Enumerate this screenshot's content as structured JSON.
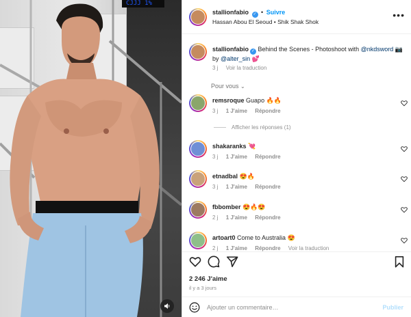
{
  "media": {
    "clock_text": "CJJJ 1%",
    "sound_icon": "speaker-icon"
  },
  "header": {
    "username": "stallionfabio",
    "follow_label": "Suivre",
    "subtitle": "Hassan Abou El Seoud • Shik Shak Shok",
    "more_icon": "more-icon"
  },
  "caption": {
    "username": "stallionfabio",
    "text_before": "Behind the Scenes - Photoshoot with",
    "mention_1": "@nkdsword",
    "text_mid": "📷 by",
    "mention_2": "@alter_sin",
    "emoji_end": "💕",
    "time": "3 j",
    "translate": "Voir la traduction"
  },
  "filter": {
    "label": "Pour vous",
    "icon": "chevron-down-icon"
  },
  "comments": [
    {
      "username": "remsroque",
      "text": "Guapo 🔥🔥",
      "time": "3 j",
      "likes": "1 J'aime",
      "reply": "Répondre",
      "avatar_color": "#8aa66b"
    },
    {
      "username": "shakaranks",
      "text": "💘",
      "time": "3 j",
      "likes": "1 J'aime",
      "reply": "Répondre",
      "avatar_color": "#6f8fd6"
    },
    {
      "username": "etnadbal",
      "text": "😍🔥",
      "time": "3 j",
      "likes": "1 J'aime",
      "reply": "Répondre",
      "avatar_color": "#c9a27a"
    },
    {
      "username": "fbbomber",
      "text": "😍🔥😍",
      "time": "2 j",
      "likes": "1 J'aime",
      "reply": "Répondre",
      "avatar_color": "#9c7a62"
    },
    {
      "username": "artoart0",
      "text": "Come to Australia 😍",
      "time": "2 j",
      "likes": "1 J'aime",
      "reply": "Répondre",
      "translate": "Voir la traduction",
      "avatar_color": "#8ebf8a"
    }
  ],
  "view_replies": "Afficher les réponses (1)",
  "actions": {
    "like_icon": "heart-icon",
    "comment_icon": "comment-icon",
    "share_icon": "share-icon",
    "save_icon": "bookmark-icon",
    "likes_count": "2 246 J'aime",
    "ago": "il y a 3 jours"
  },
  "add_comment": {
    "emoji_icon": "emoji-icon",
    "placeholder": "Ajouter un commentaire…",
    "publish": "Publier"
  },
  "colors": {
    "accent": "#0095f6",
    "verified": "#3897f0",
    "text": "#262626",
    "muted": "#8e8e8e"
  }
}
